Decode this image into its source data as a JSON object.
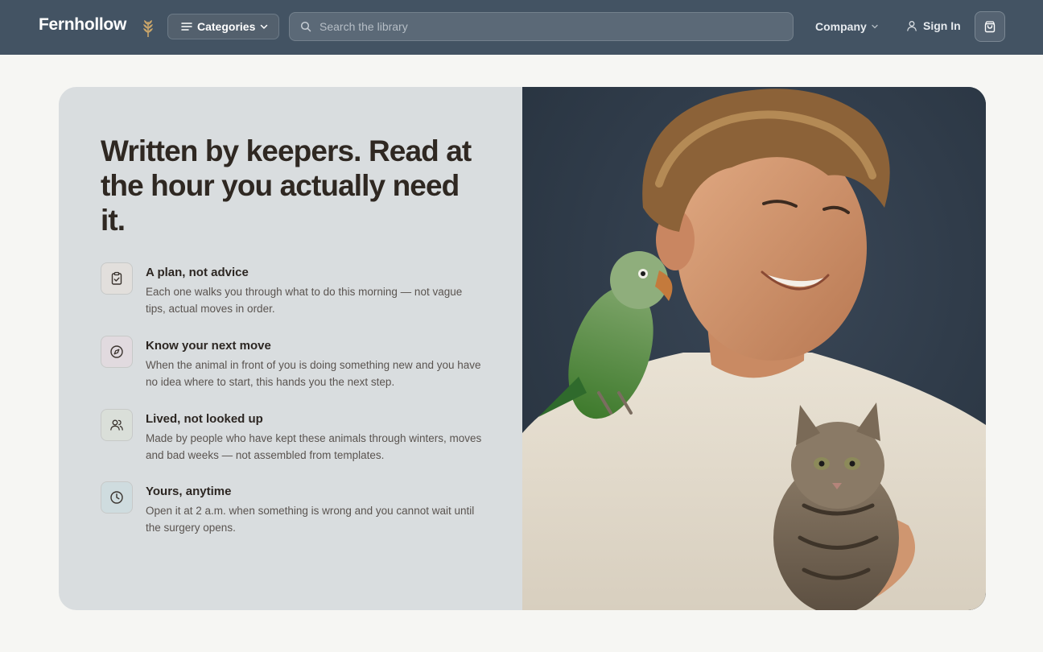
{
  "header": {
    "brand": "Fernhollow",
    "categories_label": "Categories",
    "search_placeholder": "Search the library",
    "company_label": "Company",
    "signin_label": "Sign In"
  },
  "hero": {
    "title": "Written by keepers. Read at the hour you actually need it.",
    "features": [
      {
        "icon": "clipboard-check-icon",
        "icon_bg": "#e2dfdc",
        "title": "A plan, not advice",
        "desc": "Each one walks you through what to do this morning — not vague tips, actual moves in order."
      },
      {
        "icon": "compass-icon",
        "icon_bg": "#e1dadf",
        "title": "Know your next move",
        "desc": "When the animal in front of you is doing something new and you have no idea where to start, this hands you the next step."
      },
      {
        "icon": "users-icon",
        "icon_bg": "#dadfd9",
        "title": "Lived, not looked up",
        "desc": "Made by people who have kept these animals through winters, moves and bad weeks — not assembled from templates."
      },
      {
        "icon": "clock-icon",
        "icon_bg": "#cfdcdf",
        "title": "Yours, anytime",
        "desc": "Open it at 2 a.m. when something is wrong and you cannot wait until the surgery opens."
      }
    ]
  },
  "colors": {
    "header_bg": "#435363",
    "page_bg": "#f6f6f3",
    "hero_panel_bg": "#d9dddf",
    "accent_mark": "#c9a56a"
  }
}
